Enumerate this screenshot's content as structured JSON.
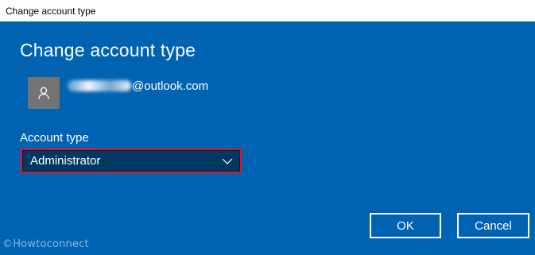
{
  "window": {
    "title": "Change account type"
  },
  "dialog": {
    "heading": "Change account type",
    "account": {
      "email_visible_part": "@outlook.com",
      "avatar_icon": "person-icon"
    },
    "account_type": {
      "label": "Account type",
      "selected": "Administrator"
    },
    "buttons": {
      "ok": "OK",
      "cancel": "Cancel"
    }
  },
  "watermark": {
    "copyright_symbol": "©",
    "text": "Howtoconnect"
  },
  "colors": {
    "background": "#0063b1",
    "select_background": "#003865",
    "highlight_border": "#e81123",
    "avatar_background": "#737373"
  }
}
